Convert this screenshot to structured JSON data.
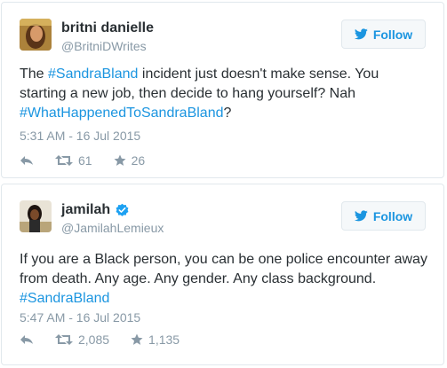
{
  "tweets": [
    {
      "name": "britni danielle",
      "handle": "@BritniDWrites",
      "follow_label": "Follow",
      "text": {
        "part1": "The ",
        "hashtag1": "#SandraBland",
        "part2": " incident just doesn't make sense. You starting a new job, then decide to hang yourself? Nah ",
        "hashtag2": "#WhatHappenedToSandraBland",
        "part3": "?"
      },
      "timestamp": "5:31 AM - 16 Jul 2015",
      "retweets": "61",
      "likes": "26",
      "verified": false
    },
    {
      "name": "jamilah",
      "handle": "@JamilahLemieux",
      "follow_label": "Follow",
      "text": {
        "part1": "If you are a Black person, you can be one police encounter away from death. Any age. Any gender. Any class background. ",
        "hashtag1": "#SandraBland"
      },
      "timestamp": "5:47 AM - 16 Jul 2015",
      "retweets": "2,085",
      "likes": "1,135",
      "verified": true
    }
  ],
  "icons": {
    "follow": "twitter-bird-icon",
    "reply": "reply-arrow-icon",
    "retweet": "retweet-icon",
    "like": "star-icon",
    "verified": "verified-badge-icon"
  },
  "colors": {
    "link": "#1b95e0",
    "muted": "#8899a6",
    "text": "#292f33",
    "border": "#e1e8ed"
  }
}
